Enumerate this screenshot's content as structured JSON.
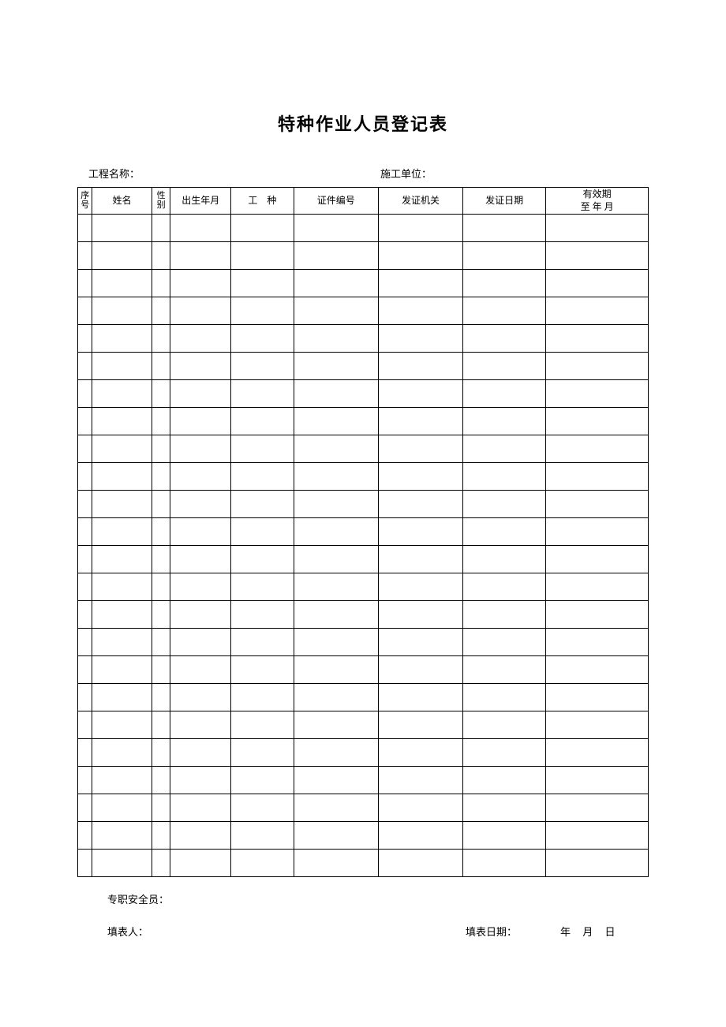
{
  "title": "特种作业人员登记表",
  "meta": {
    "project_label": "工程名称：",
    "project_value": "",
    "unit_label": "施工单位：",
    "unit_value": ""
  },
  "headers": {
    "seq": "序号",
    "name": "姓名",
    "gender": "性别",
    "birth": "出生年月",
    "work": "工　种",
    "cert": "证件编号",
    "issuer": "发证机关",
    "issuedate": "发证日期",
    "valid_line1": "有效期",
    "valid_line2": "至 年 月"
  },
  "rows": [
    {
      "seq": "",
      "name": "",
      "gender": "",
      "birth": "",
      "work": "",
      "cert": "",
      "issuer": "",
      "issuedate": "",
      "valid": ""
    },
    {
      "seq": "",
      "name": "",
      "gender": "",
      "birth": "",
      "work": "",
      "cert": "",
      "issuer": "",
      "issuedate": "",
      "valid": ""
    },
    {
      "seq": "",
      "name": "",
      "gender": "",
      "birth": "",
      "work": "",
      "cert": "",
      "issuer": "",
      "issuedate": "",
      "valid": ""
    },
    {
      "seq": "",
      "name": "",
      "gender": "",
      "birth": "",
      "work": "",
      "cert": "",
      "issuer": "",
      "issuedate": "",
      "valid": ""
    },
    {
      "seq": "",
      "name": "",
      "gender": "",
      "birth": "",
      "work": "",
      "cert": "",
      "issuer": "",
      "issuedate": "",
      "valid": ""
    },
    {
      "seq": "",
      "name": "",
      "gender": "",
      "birth": "",
      "work": "",
      "cert": "",
      "issuer": "",
      "issuedate": "",
      "valid": ""
    },
    {
      "seq": "",
      "name": "",
      "gender": "",
      "birth": "",
      "work": "",
      "cert": "",
      "issuer": "",
      "issuedate": "",
      "valid": ""
    },
    {
      "seq": "",
      "name": "",
      "gender": "",
      "birth": "",
      "work": "",
      "cert": "",
      "issuer": "",
      "issuedate": "",
      "valid": ""
    },
    {
      "seq": "",
      "name": "",
      "gender": "",
      "birth": "",
      "work": "",
      "cert": "",
      "issuer": "",
      "issuedate": "",
      "valid": ""
    },
    {
      "seq": "",
      "name": "",
      "gender": "",
      "birth": "",
      "work": "",
      "cert": "",
      "issuer": "",
      "issuedate": "",
      "valid": ""
    },
    {
      "seq": "",
      "name": "",
      "gender": "",
      "birth": "",
      "work": "",
      "cert": "",
      "issuer": "",
      "issuedate": "",
      "valid": ""
    },
    {
      "seq": "",
      "name": "",
      "gender": "",
      "birth": "",
      "work": "",
      "cert": "",
      "issuer": "",
      "issuedate": "",
      "valid": ""
    },
    {
      "seq": "",
      "name": "",
      "gender": "",
      "birth": "",
      "work": "",
      "cert": "",
      "issuer": "",
      "issuedate": "",
      "valid": ""
    },
    {
      "seq": "",
      "name": "",
      "gender": "",
      "birth": "",
      "work": "",
      "cert": "",
      "issuer": "",
      "issuedate": "",
      "valid": ""
    },
    {
      "seq": "",
      "name": "",
      "gender": "",
      "birth": "",
      "work": "",
      "cert": "",
      "issuer": "",
      "issuedate": "",
      "valid": ""
    },
    {
      "seq": "",
      "name": "",
      "gender": "",
      "birth": "",
      "work": "",
      "cert": "",
      "issuer": "",
      "issuedate": "",
      "valid": ""
    },
    {
      "seq": "",
      "name": "",
      "gender": "",
      "birth": "",
      "work": "",
      "cert": "",
      "issuer": "",
      "issuedate": "",
      "valid": ""
    },
    {
      "seq": "",
      "name": "",
      "gender": "",
      "birth": "",
      "work": "",
      "cert": "",
      "issuer": "",
      "issuedate": "",
      "valid": ""
    },
    {
      "seq": "",
      "name": "",
      "gender": "",
      "birth": "",
      "work": "",
      "cert": "",
      "issuer": "",
      "issuedate": "",
      "valid": ""
    },
    {
      "seq": "",
      "name": "",
      "gender": "",
      "birth": "",
      "work": "",
      "cert": "",
      "issuer": "",
      "issuedate": "",
      "valid": ""
    },
    {
      "seq": "",
      "name": "",
      "gender": "",
      "birth": "",
      "work": "",
      "cert": "",
      "issuer": "",
      "issuedate": "",
      "valid": ""
    },
    {
      "seq": "",
      "name": "",
      "gender": "",
      "birth": "",
      "work": "",
      "cert": "",
      "issuer": "",
      "issuedate": "",
      "valid": ""
    },
    {
      "seq": "",
      "name": "",
      "gender": "",
      "birth": "",
      "work": "",
      "cert": "",
      "issuer": "",
      "issuedate": "",
      "valid": ""
    },
    {
      "seq": "",
      "name": "",
      "gender": "",
      "birth": "",
      "work": "",
      "cert": "",
      "issuer": "",
      "issuedate": "",
      "valid": ""
    }
  ],
  "footer": {
    "safety_officer_label": "专职安全员：",
    "safety_officer_value": "",
    "filler_label": "填表人：",
    "filler_value": "",
    "fill_date_label": "填表日期：",
    "fill_date_value": "年 月 日"
  }
}
